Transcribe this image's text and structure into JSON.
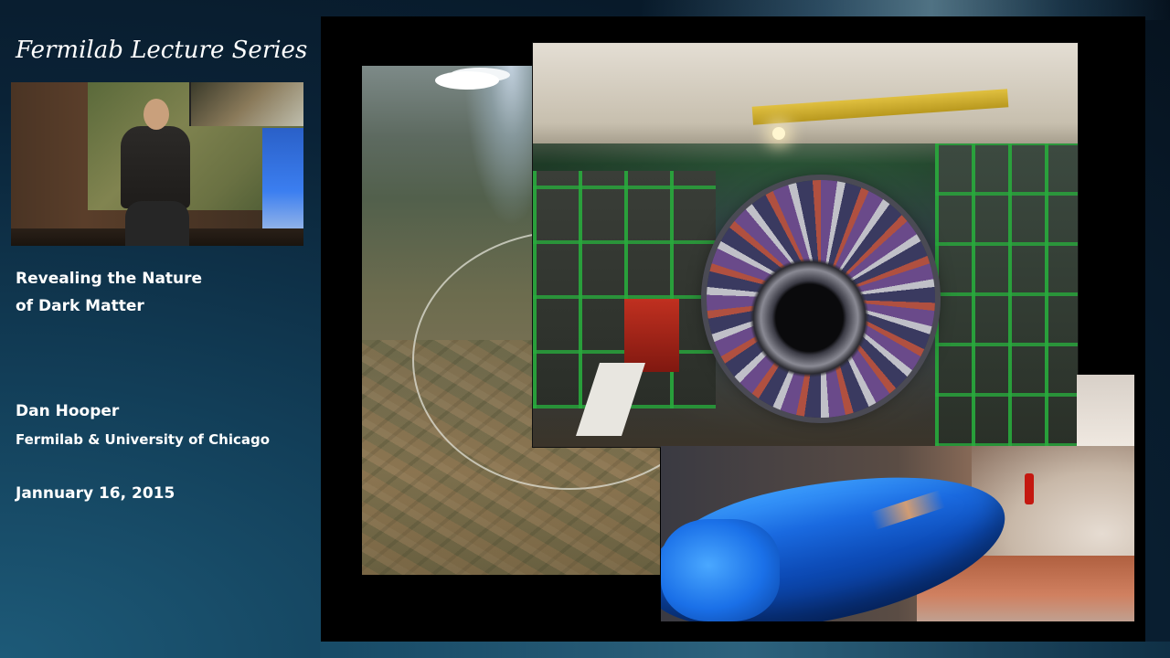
{
  "series": {
    "title": "Fermilab Lecture Series"
  },
  "talk": {
    "title_line1": "Revealing the Nature",
    "title_line2": "of Dark Matter"
  },
  "speaker": {
    "name": "Dan Hooper",
    "affiliation": "Fermilab & University of Chicago"
  },
  "event": {
    "date": "Jannuary 16, 2015"
  },
  "slide": {
    "images": [
      {
        "name": "aerial-lhc-ring-photo"
      },
      {
        "name": "cms-detector-photo"
      },
      {
        "name": "lhc-tunnel-magnet-photo"
      }
    ]
  },
  "colors": {
    "background_dark": "#06121e",
    "background_teal": "#1d5a78",
    "text": "#ffffff",
    "slide_background": "#000000"
  }
}
